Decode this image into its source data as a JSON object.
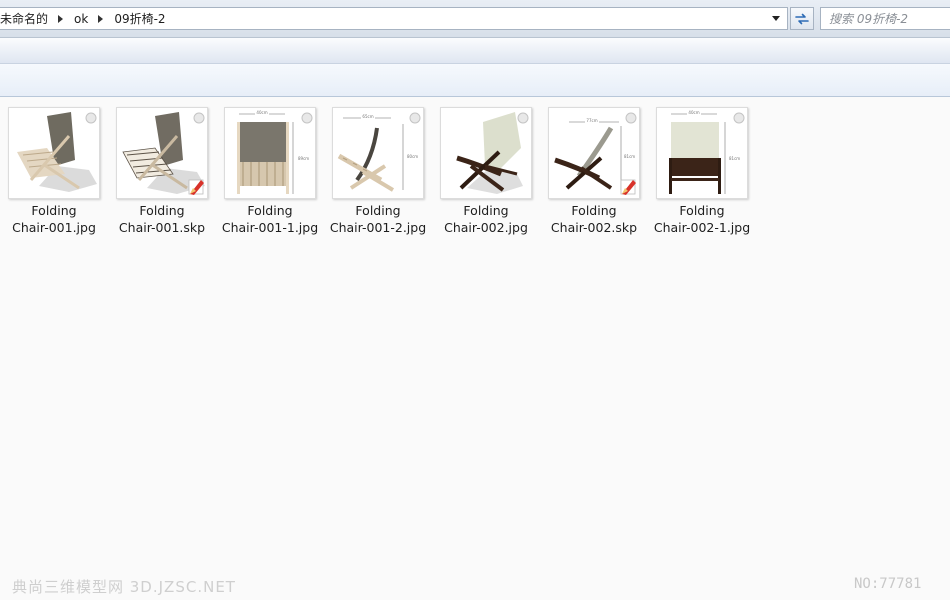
{
  "breadcrumbs": [
    "未命名的",
    "ok",
    "09折椅-2"
  ],
  "search": {
    "placeholder": "搜索 09折椅-2"
  },
  "files": [
    {
      "name_line1": "Folding",
      "name_line2": "Chair-001.jpg",
      "type": "jpg",
      "icon": "chair-001-render-icon"
    },
    {
      "name_line1": "Folding",
      "name_line2": "Chair-001.skp",
      "type": "skp",
      "icon": "chair-001-model-icon"
    },
    {
      "name_line1": "Folding",
      "name_line2": "Chair-001-1.jpg",
      "type": "jpg",
      "icon": "chair-001-front-view-icon"
    },
    {
      "name_line1": "Folding",
      "name_line2": "Chair-001-2.jpg",
      "type": "jpg",
      "icon": "chair-001-side-view-icon"
    },
    {
      "name_line1": "Folding",
      "name_line2": "Chair-002.jpg",
      "type": "jpg",
      "icon": "chair-002-render-icon"
    },
    {
      "name_line1": "Folding",
      "name_line2": "Chair-002.skp",
      "type": "skp",
      "icon": "chair-002-model-icon"
    },
    {
      "name_line1": "Folding",
      "name_line2": "Chair-002-1.jpg",
      "type": "jpg",
      "icon": "chair-002-front-view-icon"
    }
  ],
  "watermark": {
    "left": "典尚三维模型网 3D.JZSC.NET",
    "right": "NO:77781"
  },
  "colors": {
    "address_border": "#a7b3c2",
    "pane_background": "#fafafa",
    "chair1_fabric": "#6f6b60",
    "chair1_wood": "#d9c8ad",
    "chair2_fabric": "#dcdfcd",
    "chair2_wood": "#3b2418",
    "sketchup_badge": "#d8322a"
  }
}
